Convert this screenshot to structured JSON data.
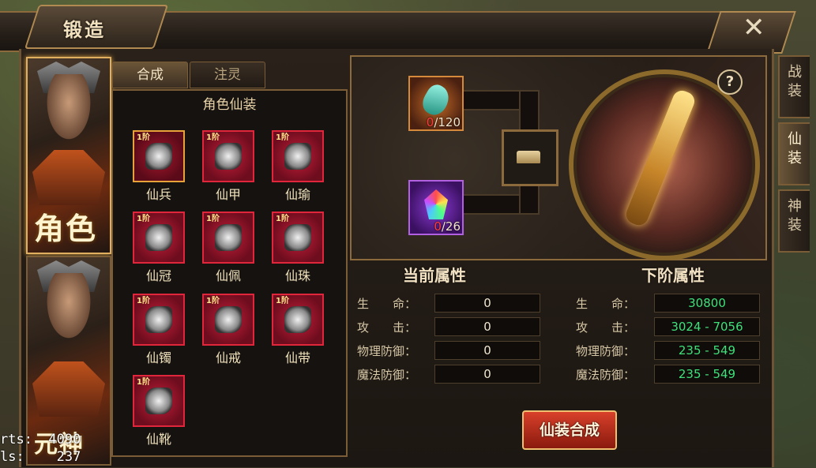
{
  "window": {
    "title": "锻造",
    "close_label": "✕"
  },
  "portraits": [
    {
      "label": "角色"
    },
    {
      "label": "元神"
    }
  ],
  "tabs": [
    {
      "label": "合成"
    },
    {
      "label": "注灵"
    }
  ],
  "section": {
    "title": "角色仙装"
  },
  "items": [
    {
      "level": "1阶",
      "name": "仙兵"
    },
    {
      "level": "1阶",
      "name": "仙甲"
    },
    {
      "level": "1阶",
      "name": "仙瑜"
    },
    {
      "level": "1阶",
      "name": "仙冠"
    },
    {
      "level": "1阶",
      "name": "仙佩"
    },
    {
      "level": "1阶",
      "name": "仙珠"
    },
    {
      "level": "1阶",
      "name": "仙镯"
    },
    {
      "level": "1阶",
      "name": "仙戒"
    },
    {
      "level": "1阶",
      "name": "仙带"
    },
    {
      "level": "1阶",
      "name": "仙靴"
    }
  ],
  "materials": [
    {
      "have": "0",
      "need": "/120",
      "icon": "jade-gem-icon"
    },
    {
      "have": "0",
      "need": "/26",
      "icon": "rainbow-crystal-icon"
    }
  ],
  "help_label": "?",
  "current": {
    "title": "当前属性",
    "rows": [
      {
        "label": "生　　命：",
        "value": "0"
      },
      {
        "label": "攻　　击：",
        "value": "0"
      },
      {
        "label": "物理防御：",
        "value": "0"
      },
      {
        "label": "魔法防御：",
        "value": "0"
      }
    ]
  },
  "next": {
    "title": "下阶属性",
    "rows": [
      {
        "label": "生　　命：",
        "value": "30800"
      },
      {
        "label": "攻　　击：",
        "value": "3024 - 7056"
      },
      {
        "label": "物理防御：",
        "value": "235 - 549"
      },
      {
        "label": "魔法防御：",
        "value": "235 - 549"
      }
    ]
  },
  "forge_button": "仙装合成",
  "side_tabs": [
    {
      "label": "战装"
    },
    {
      "label": "仙装"
    },
    {
      "label": "神装"
    }
  ],
  "debug": {
    "line1": "rts:  4090",
    "line2": "ls:    237"
  }
}
